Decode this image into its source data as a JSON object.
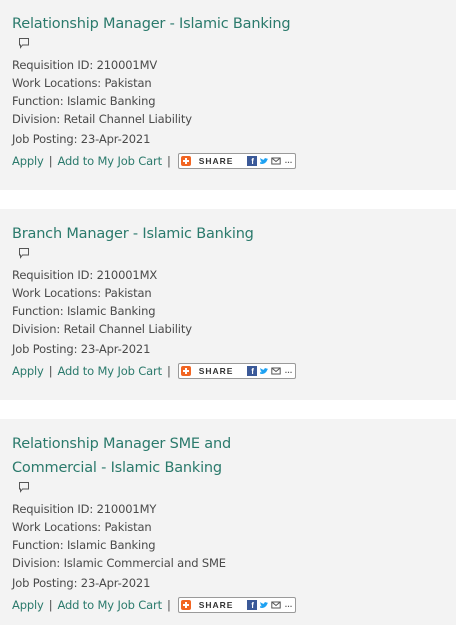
{
  "jobs": [
    {
      "title": "Relationship Manager - Islamic Banking",
      "requisition": "Requisition ID: 210001MV",
      "locations": "Work Locations: Pakistan",
      "function": "Function: Islamic Banking",
      "division": "Division: Retail Channel Liability",
      "posting": "Job Posting: 23-Apr-2021",
      "apply": "Apply",
      "cart": "Add to My Job Cart",
      "share": "SHARE"
    },
    {
      "title": "Branch Manager - Islamic Banking",
      "requisition": "Requisition ID: 210001MX",
      "locations": "Work Locations: Pakistan",
      "function": "Function: Islamic Banking",
      "division": "Division: Retail Channel Liability",
      "posting": "Job Posting: 23-Apr-2021",
      "apply": "Apply",
      "cart": "Add to My Job Cart",
      "share": "SHARE"
    },
    {
      "title": "Relationship Manager SME and Commercial - Islamic Banking",
      "requisition": "Requisition ID: 210001MY",
      "locations": "Work Locations: Pakistan",
      "function": "Function: Islamic Banking",
      "division": "Division: Islamic Commercial and SME",
      "posting": "Job Posting: 23-Apr-2021",
      "apply": "Apply",
      "cart": "Add to My Job Cart",
      "share": "SHARE"
    }
  ],
  "separator": "|",
  "icons": {
    "comment": "comment-icon",
    "share_plus": "addthis-plus-icon",
    "facebook": "facebook-icon",
    "twitter": "twitter-icon",
    "email": "email-icon",
    "more": "more-icon"
  },
  "colors": {
    "link": "#2b7a6c",
    "card_bg": "#f3f3f3",
    "text": "#4a4a4a",
    "share_accent": "#f26522",
    "facebook": "#3b5998",
    "twitter": "#1da1f2"
  }
}
